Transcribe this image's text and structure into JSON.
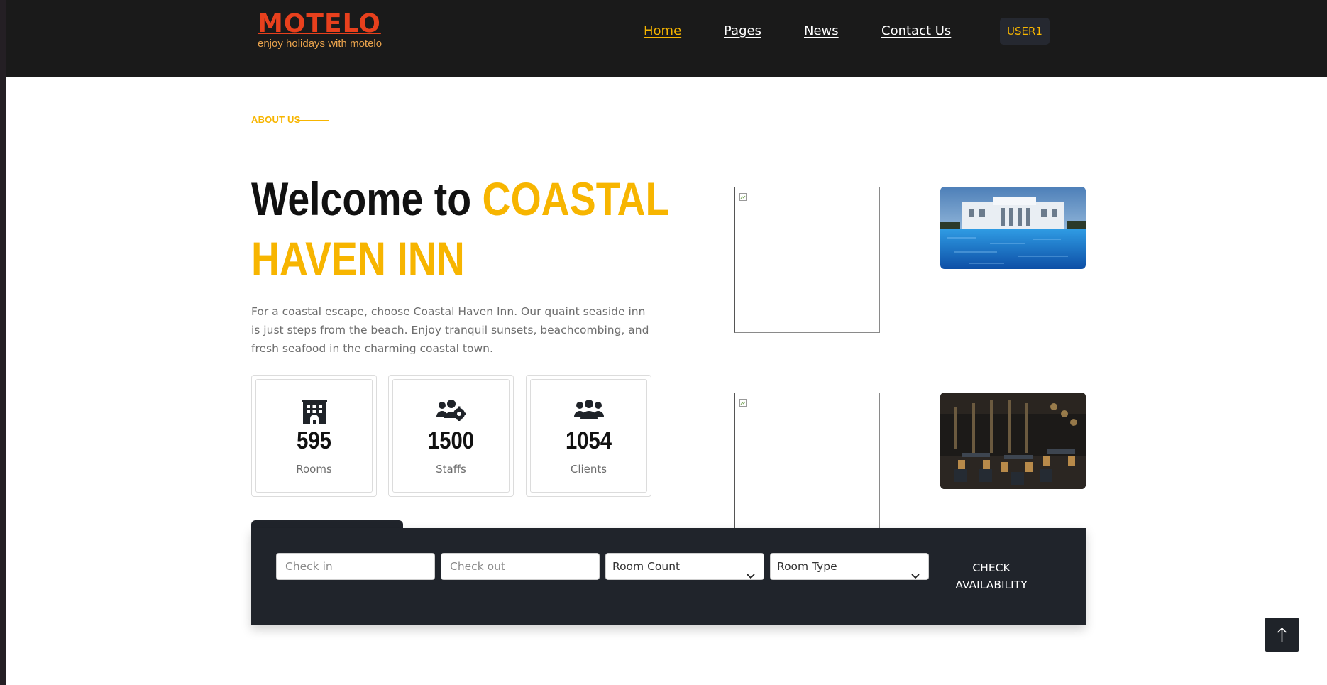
{
  "brand": {
    "name": "MOTELO",
    "tagline": "enjoy holidays with motelo"
  },
  "nav": {
    "items": [
      {
        "label": "Home",
        "active": true
      },
      {
        "label": "Pages",
        "active": false
      },
      {
        "label": "News",
        "active": false
      },
      {
        "label": "Contact Us",
        "active": false
      }
    ],
    "user_label": "USER1"
  },
  "about": {
    "eyebrow": "ABOUT US",
    "heading_plain": "Welcome to",
    "heading_highlight_1": "COASTAL",
    "heading_highlight_2": "HAVEN INN",
    "description": "For a coastal escape, choose Coastal Haven Inn. Our quaint seaside inn is just steps from the beach. Enjoy tranquil sunsets, beachcombing, and fresh seafood in the charming coastal town."
  },
  "stats": [
    {
      "icon": "hotel-building-icon",
      "value": "595",
      "label": "Rooms"
    },
    {
      "icon": "users-gear-icon",
      "value": "1500",
      "label": "Staffs"
    },
    {
      "icon": "users-icon",
      "value": "1054",
      "label": "Clients"
    }
  ],
  "gallery": {
    "images": [
      {
        "icon": "broken-image-icon",
        "loaded": false
      },
      {
        "icon": "hotel-pool-photo",
        "loaded": true
      },
      {
        "icon": "broken-image-icon",
        "loaded": false
      },
      {
        "icon": "restaurant-interior-photo",
        "loaded": true
      }
    ]
  },
  "booking": {
    "check_in_placeholder": "Check in",
    "check_out_placeholder": "Check out",
    "room_count_label": "Room Count",
    "room_type_label": "Room Type",
    "check_button_line1": "CHECK",
    "check_button_line2": "AVAILABILITY"
  },
  "back_to_top_icon": "arrow-up-icon",
  "colors": {
    "accent": "#f7b500",
    "brand_red": "#e8401d",
    "header_bg": "#1a1a1a",
    "panel_bg": "#20242b"
  }
}
